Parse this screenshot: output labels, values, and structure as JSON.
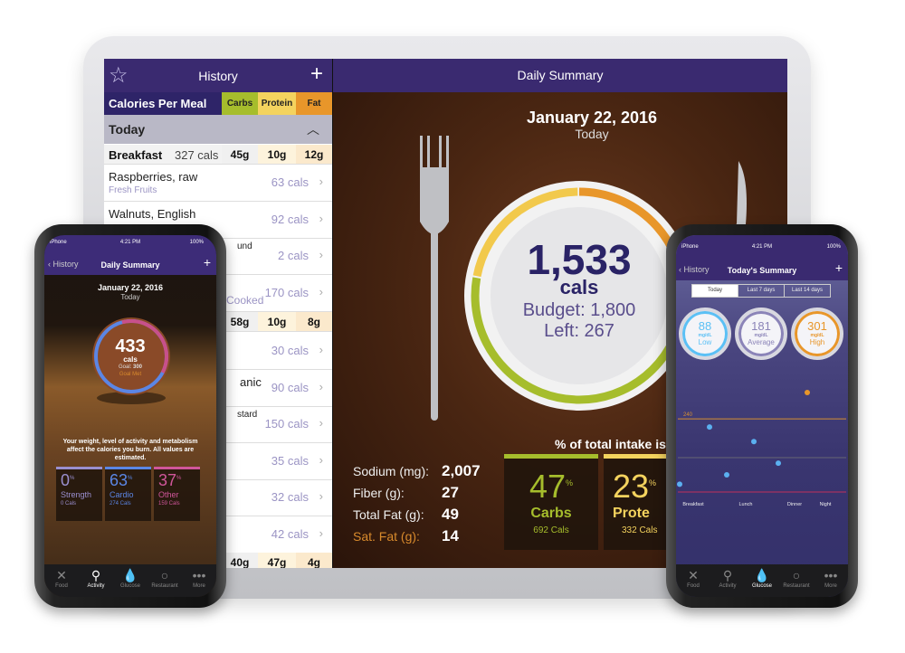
{
  "tablet": {
    "list": {
      "title": "History",
      "star_icon": "star-icon",
      "add_icon": "plus-icon",
      "columns": {
        "title": "Calories Per Meal",
        "carbs": "Carbs",
        "protein": "Protein",
        "fat": "Fat"
      },
      "colors": {
        "carbs": "#a6bd2c",
        "protein": "#f4d35e",
        "fat": "#e8962a",
        "header": "#3a2a70"
      },
      "section": "Today",
      "meals": [
        {
          "name": "Breakfast",
          "cals": "327 cals",
          "carbs": "45g",
          "protein": "10g",
          "fat": "12g"
        },
        {
          "name": "",
          "cals": "",
          "carbs": "58g",
          "protein": "10g",
          "fat": "8g"
        },
        {
          "name": "",
          "cals": "",
          "carbs": "40g",
          "protein": "47g",
          "fat": "4g"
        }
      ],
      "items": [
        {
          "name": "Raspberries, raw",
          "sub": "Fresh Fruits",
          "cals": "63 cals"
        },
        {
          "name": "Walnuts, English",
          "sub": "",
          "cals": "92 cals"
        },
        {
          "name": "und",
          "sub": "",
          "cals": "2 cals"
        },
        {
          "name": "",
          "sub": "Cooked",
          "cals": "170 cals"
        },
        {
          "name": "",
          "sub": "",
          "cals": "30 cals"
        },
        {
          "name": "anic",
          "sub": "",
          "cals": "90 cals"
        },
        {
          "name": "stard",
          "sub": "",
          "cals": "150 cals"
        },
        {
          "name": "",
          "sub": "",
          "cals": "35 cals"
        },
        {
          "name": "",
          "sub": "",
          "cals": "32 cals"
        },
        {
          "name": "",
          "sub": "",
          "cals": "42 cals"
        }
      ]
    },
    "main": {
      "title": "Daily Summary",
      "date": "January 22, 2016",
      "day": "Today",
      "calories": "1,533",
      "cals_label": "cals",
      "budget": "Budget: 1,800",
      "left": "Left: 267",
      "stats": [
        {
          "label": "Sodium (mg):",
          "value": "2,007"
        },
        {
          "label": "Fiber (g):",
          "value": "27"
        },
        {
          "label": "Total Fat (g):",
          "value": "49"
        },
        {
          "label": "Sat. Fat (g):",
          "value": "14"
        }
      ],
      "intake_title": "% of total intake is",
      "intake": [
        {
          "pct": "47",
          "name": "Carbs",
          "cals": "692 Cals",
          "color": "#a6bd2c"
        },
        {
          "pct": "23",
          "name": "Prote",
          "cals": "332 Cals",
          "color": "#f4d35e"
        }
      ],
      "pct_sign": "%"
    }
  },
  "left_phone": {
    "carrier": "iPhone",
    "time": "4:21 PM",
    "battery": "100%",
    "back": "History",
    "title": "Daily Summary",
    "date": "January 22, 2016",
    "day": "Today",
    "calories": "433",
    "cals_label": "cals",
    "goal_label": "Goal:",
    "goal": "300",
    "goal_status": "Goal Met",
    "note": "Your weight, level of activity and metabolism affect the calories you burn. All values are estimated.",
    "boxes": [
      {
        "pct": "0",
        "name": "Strength",
        "cals": "0 Cals",
        "color": "#9a8fcf"
      },
      {
        "pct": "63",
        "name": "Cardio",
        "cals": "274 Cals",
        "color": "#5b86e5"
      },
      {
        "pct": "37",
        "name": "Other",
        "cals": "159 Cals",
        "color": "#d0569a"
      }
    ],
    "tabs": [
      {
        "label": "Food",
        "icon": "fork-knife-icon"
      },
      {
        "label": "Activity",
        "icon": "bicycle-icon",
        "active": true
      },
      {
        "label": "Glucose",
        "icon": "drop-icon"
      },
      {
        "label": "Restaurant",
        "icon": "plate-icon"
      },
      {
        "label": "More",
        "icon": "more-icon"
      }
    ]
  },
  "right_phone": {
    "carrier": "iPhone",
    "time": "4:21 PM",
    "battery": "100%",
    "back": "History",
    "title": "Today's Summary",
    "segments": [
      "Today",
      "Last 7 days",
      "Last 14 days"
    ],
    "selected_segment": "Today",
    "readings": [
      {
        "value": "88",
        "unit": "mg/dL",
        "label": "Low",
        "color": "#5bc0f5"
      },
      {
        "value": "181",
        "unit": "mg/dL",
        "label": "Average",
        "color": "#8b84b8"
      },
      {
        "value": "301",
        "unit": "mg/dL",
        "label": "High",
        "color": "#e8962a"
      }
    ],
    "threshold_label": "240",
    "points": [
      88,
      221,
      110,
      187,
      137,
      301
    ],
    "x_labels": [
      "Breakfast",
      "Lunch",
      "Dinner",
      "Night"
    ],
    "tabs": [
      {
        "label": "Food",
        "icon": "fork-knife-icon"
      },
      {
        "label": "Activity",
        "icon": "bicycle-icon"
      },
      {
        "label": "Glucose",
        "icon": "drop-icon",
        "active": true
      },
      {
        "label": "Restaurant",
        "icon": "plate-icon"
      },
      {
        "label": "More",
        "icon": "more-icon"
      }
    ]
  }
}
